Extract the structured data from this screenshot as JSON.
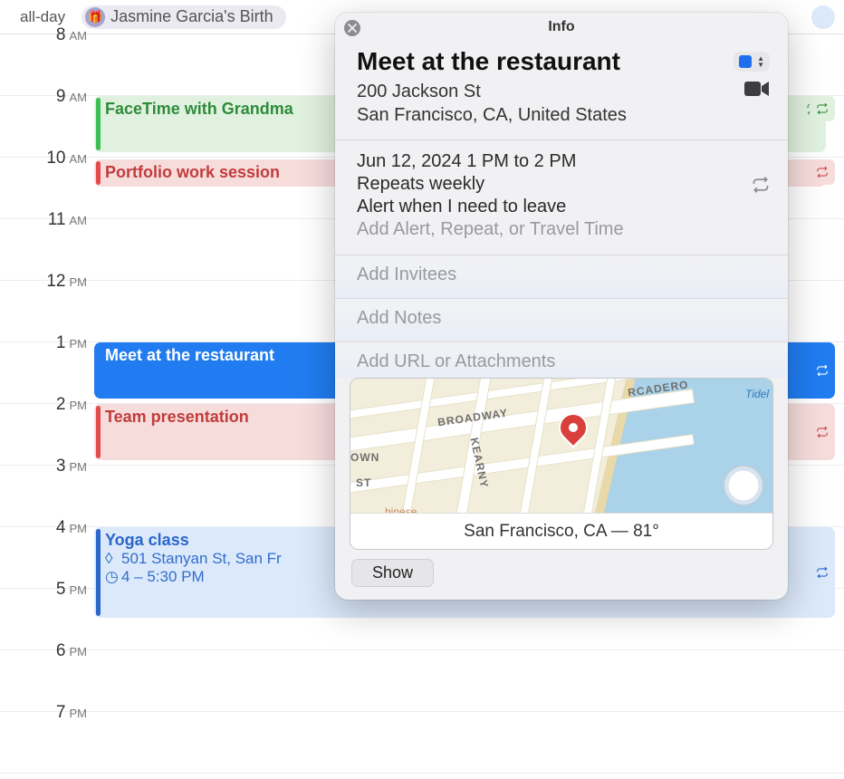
{
  "allday": {
    "label": "all-day",
    "chip": "Jasmine Garcia's Birth"
  },
  "hours": [
    "8 AM",
    "9 AM",
    "10 AM",
    "11 AM",
    "12 PM",
    "1 PM",
    "2 PM",
    "3 PM",
    "4 PM",
    "5 PM",
    "6 PM",
    "7 PM"
  ],
  "events": {
    "facetime": {
      "title": "FaceTime with Grandma"
    },
    "portfolio": {
      "title": "Portfolio work session"
    },
    "meet": {
      "title": "Meet at the restaurant"
    },
    "team": {
      "title": "Team presentation"
    },
    "yoga": {
      "title": "Yoga class",
      "location": "501 Stanyan St, San Fr",
      "time": "4 – 5:30 PM"
    }
  },
  "popover": {
    "titlebar": "Info",
    "title": "Meet at the restaurant",
    "addr1": "200 Jackson St",
    "addr2": "San Francisco, CA, United States",
    "date_time": "Jun 12, 2024  1 PM to 2 PM",
    "repeat": "Repeats weekly",
    "alert": "Alert when I need to leave",
    "add_alert": "Add Alert, Repeat, or Travel Time",
    "add_invitees": "Add Invitees",
    "add_notes": "Add Notes",
    "add_url": "Add URL or Attachments",
    "map_footer": "San Francisco, CA — 81°",
    "show": "Show",
    "calendar_color": "#1f6ef0"
  },
  "map_labels": {
    "broadway": "BROADWAY",
    "embarcadero": "RCADERO",
    "kearny": "KEARNY",
    "own": "OWN",
    "st": "ST",
    "chinese": "hinese",
    "tidel": "Tidel"
  }
}
